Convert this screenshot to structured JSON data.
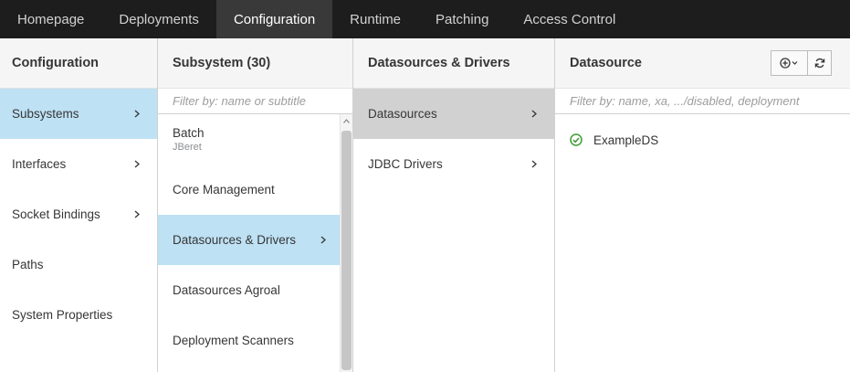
{
  "nav": {
    "tabs": [
      {
        "label": "Homepage",
        "active": false
      },
      {
        "label": "Deployments",
        "active": false
      },
      {
        "label": "Configuration",
        "active": true
      },
      {
        "label": "Runtime",
        "active": false
      },
      {
        "label": "Patching",
        "active": false
      },
      {
        "label": "Access Control",
        "active": false
      }
    ]
  },
  "col1": {
    "title": "Configuration",
    "items": [
      {
        "label": "Subsystems",
        "selected": true,
        "chevron": true
      },
      {
        "label": "Interfaces",
        "selected": false,
        "chevron": true
      },
      {
        "label": "Socket Bindings",
        "selected": false,
        "chevron": true
      },
      {
        "label": "Paths",
        "selected": false,
        "chevron": false
      },
      {
        "label": "System Properties",
        "selected": false,
        "chevron": false
      }
    ]
  },
  "col2": {
    "title": "Subsystem (30)",
    "filter_placeholder": "Filter by: name or subtitle",
    "items": [
      {
        "label": "Batch",
        "subtitle": "JBeret"
      },
      {
        "label": "Core Management"
      },
      {
        "label": "Datasources & Drivers",
        "selected": true
      },
      {
        "label": "Datasources Agroal"
      },
      {
        "label": "Deployment Scanners"
      }
    ]
  },
  "col3": {
    "title": "Datasources & Drivers",
    "items": [
      {
        "label": "Datasources",
        "selected": true
      },
      {
        "label": "JDBC Drivers"
      }
    ]
  },
  "col4": {
    "title": "Datasource",
    "filter_placeholder": "Filter by: name, xa, .../disabled, deployment",
    "items": [
      {
        "label": "ExampleDS",
        "status": "ok"
      }
    ]
  },
  "colors": {
    "nav_bg": "#1d1d1d",
    "nav_active": "#393939",
    "selected_blue": "#bee1f4",
    "selected_gray": "#d1d1d1",
    "ok_green": "#3f9c35"
  }
}
